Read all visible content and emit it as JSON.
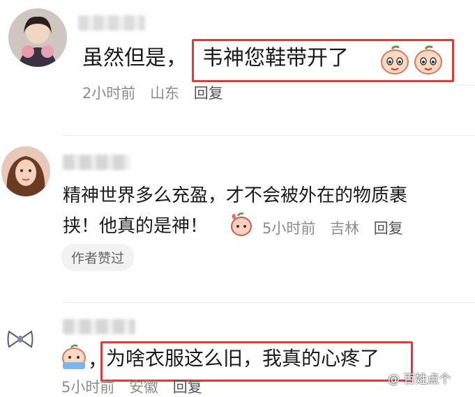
{
  "comments": [
    {
      "text_prefix": "虽然但是，",
      "text_highlight": "韦神您鞋带开了",
      "time": "2小时前",
      "location": "山东",
      "reply_label": "回复"
    },
    {
      "text_line1": "精神世界多么充盈，才不会被外在的物质裹",
      "text_line2": "挟！他真的是神！",
      "time": "5小时前",
      "location": "吉林",
      "reply_label": "回复",
      "badge": "作者赞过"
    },
    {
      "text_prefix": "，",
      "text_highlight": "为啥衣服这么旧，我真的心疼了",
      "time": "5小时前",
      "location": "安徽",
      "reply_label": "回复"
    }
  ],
  "watermark": {
    "symbol": "@",
    "text": "百姓点个"
  },
  "colors": {
    "highlight_border": "#e03a3a",
    "meta_text": "#8c8c8c",
    "body_text": "#1a1a1a"
  }
}
